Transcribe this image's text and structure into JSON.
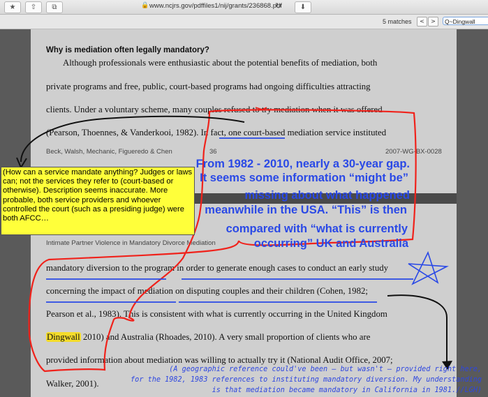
{
  "browser": {
    "url": "www.ncjrs.gov/pdffiles1/nij/grants/236868.pdf",
    "buttons": [
      "★",
      "⇧",
      "⧉"
    ],
    "refresh": "↻",
    "download": "⬇"
  },
  "find": {
    "matches": "5 matches",
    "prev": "<",
    "next": ">",
    "query": "Q~Dingwall"
  },
  "page1": {
    "heading": "Why is mediation often legally mandatory?",
    "lines": [
      "Although professionals were enthusiastic about the potential benefits of mediation, both",
      "private programs and free, public, court-based programs had ongoing difficulties attracting",
      "clients. Under a voluntary scheme, many couples refused to try mediation when it was offered",
      "(Pearson, Thoennes, & Vanderkooi, 1982). In fact, one court-based mediation service instituted"
    ],
    "footer_left": "Beck, Walsh, Mechanic, Figueredo & Chen",
    "footer_page": "36",
    "footer_right": "2007-WG-BX-0028"
  },
  "page2": {
    "running_head": "Intimate Partner Violence in Mandatory Divorce Mediation",
    "lines": [
      "mandatory diversion to the program in order to generate enough cases to conduct an early study",
      "concerning the impact of mediation on disputing couples and their children (Cohen, 1982;",
      "Pearson et al., 1983). This is consistent with what is currently occurring in the United Kingdom",
      "2010) and Australia (Rhoades, 2010). A very small proportion of clients who are",
      "provided information about mediation was willing to actually try it (National Audit Office, 2007;",
      "Walker, 2001)."
    ],
    "highlight": "Dingwall"
  },
  "annotations": {
    "yellow_note": "(How can a service mandate anything?  Judges or laws can; not the services they refer to (court-based or otherwise).  Description seems inaccurate. More probable, both service providers and whoever controlled the court (such as a presiding judge) were both AFCC…",
    "blue_lines": [
      "From 1982 - 2010, nearly a 30-year gap.",
      "It seems some information “might be”",
      "missing about what happened",
      "meanwhile in the USA. “This” is then",
      "compared with “what is currently",
      "occurring” UK and Australia"
    ],
    "bottom_lines": [
      "(A geographic reference could've been — but wasn't — provided right here,",
      "for the 1982, 1983 references to instituting mandatory diversion. My understanding",
      "is that mediation became mandatory in California in 1981.//LGH)"
    ],
    "colors": {
      "red": "#f0221b",
      "blue": "#2a49e6",
      "yellow": "#ffff3a"
    }
  }
}
